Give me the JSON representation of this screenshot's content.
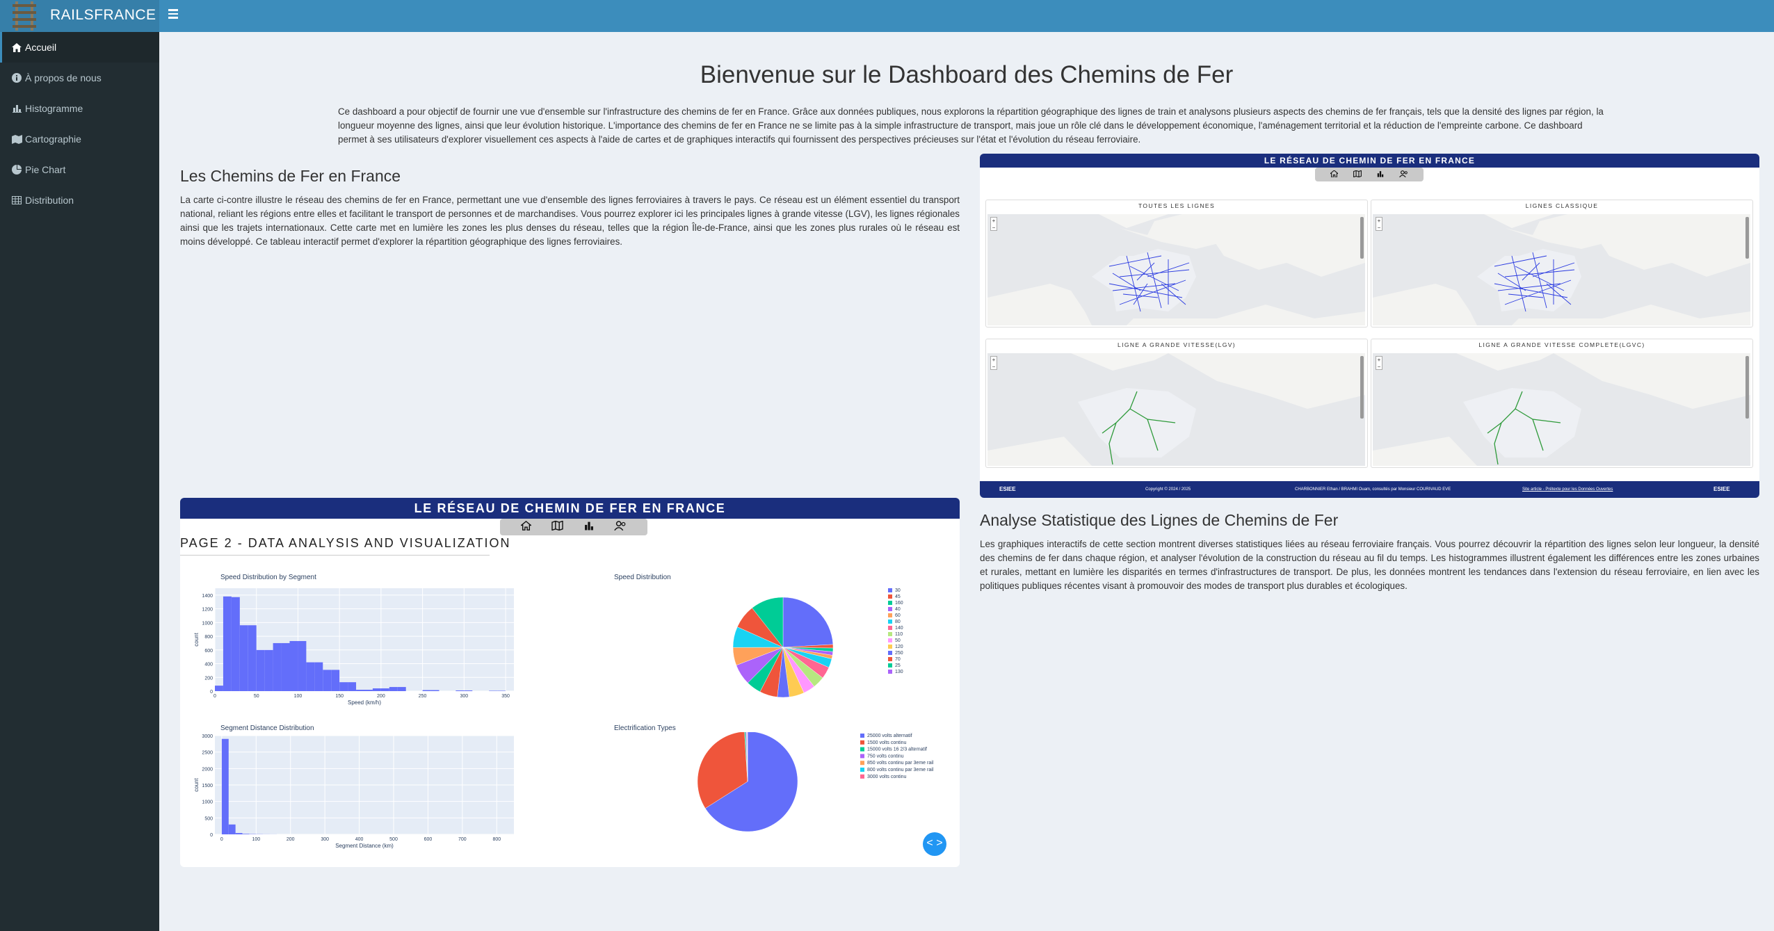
{
  "app": {
    "brand": "RAILSFRANCE"
  },
  "sidebar": {
    "items": [
      {
        "label": "Accueil",
        "icon": "home-icon",
        "active": true
      },
      {
        "label": "À propos de nous",
        "icon": "info-icon"
      },
      {
        "label": "Histogramme",
        "icon": "bar-chart-icon"
      },
      {
        "label": "Cartographie",
        "icon": "map-icon"
      },
      {
        "label": "Pie Chart",
        "icon": "pie-chart-icon"
      },
      {
        "label": "Distribution",
        "icon": "table-icon"
      }
    ]
  },
  "main": {
    "title": "Bienvenue sur le Dashboard des Chemins de Fer",
    "intro": "Ce dashboard a pour objectif de fournir une vue d'ensemble sur l'infrastructure des chemins de fer en France. Grâce aux données publiques, nous explorons la répartition géographique des lignes de train et analysons plusieurs aspects des chemins de fer français, tels que la densité des lignes par région, la longueur moyenne des lignes, ainsi que leur évolution historique. L'importance des chemins de fer en France ne se limite pas à la simple infrastructure de transport, mais joue un rôle clé dans le développement économique, l'aménagement territorial et la réduction de l'empreinte carbone. Ce dashboard permet à ses utilisateurs d'explorer visuellement ces aspects à l'aide de cartes et de graphiques interactifs qui fournissent des perspectives précieuses sur l'état et l'évolution du réseau ferroviaire.",
    "section1": {
      "heading": "Les Chemins de Fer en France",
      "text": "La carte ci-contre illustre le réseau des chemins de fer en France, permettant une vue d'ensemble des lignes ferroviaires à travers le pays. Ce réseau est un élément essentiel du transport national, reliant les régions entre elles et facilitant le transport de personnes et de marchandises. Vous pourrez explorer ici les principales lignes à grande vitesse (LGV), les lignes régionales ainsi que les trajets internationaux. Cette carte met en lumière les zones les plus denses du réseau, telles que la région Île-de-France, ainsi que les zones plus rurales où le réseau est moins développé. Ce tableau interactif permet d'explorer la répartition géographique des lignes ferroviaires."
    },
    "section2": {
      "heading": "Analyse Statistique des Lignes de Chemins de Fer",
      "text": "Les graphiques interactifs de cette section montrent diverses statistiques liées au réseau ferroviaire français. Vous pourrez découvrir la répartition des lignes selon leur longueur, la densité des chemins de fer dans chaque région, et analyser l'évolution de la construction du réseau au fil du temps. Les histogrammes illustrent également les différences entre les zones urbaines et rurales, mettant en lumière les disparités en termes d'infrastructures de transport. De plus, les données montrent les tendances dans l'extension du réseau ferroviaire, en lien avec les politiques publiques récentes visant à promouvoir des modes de transport plus durables et écologiques."
    }
  },
  "map_panel": {
    "banner": "LE RÉSEAU DE CHEMIN DE FER EN FRANCE",
    "maps": [
      {
        "title": "TOUTES LES LIGNES"
      },
      {
        "title": "LIGNES CLASSIQUE"
      },
      {
        "title": "LIGNE A GRANDE VITESSE(LGV)"
      },
      {
        "title": "LIGNE A GRANDE VITESSE COMPLETE(LGVC)"
      }
    ],
    "footer": {
      "logo_left": "ESIEE",
      "copyright": "Copyright © 2024 / 2025",
      "credits": "CHARBONNIER Ethan / BRAHMI Ouam, consultés par Monsieur COURIVAUD EVE",
      "source": "Site article - Prétexte pour les Données Ouvertes",
      "logo_right": "ESIEE"
    }
  },
  "data_panel": {
    "banner": "LE RÉSEAU DE CHEMIN DE FER EN FRANCE",
    "subtitle": "PAGE 2 - DATA ANALYSIS AND VISUALIZATION",
    "toggle": "< >"
  },
  "chart_data": [
    {
      "type": "bar",
      "title": "Speed Distribution by Segment",
      "xlabel": "Speed (km/h)",
      "ylabel": "count",
      "x": [
        5,
        15,
        25,
        35,
        45,
        55,
        65,
        75,
        85,
        95,
        105,
        115,
        125,
        135,
        145,
        155,
        165,
        175,
        185,
        195,
        205,
        215,
        225,
        235,
        245,
        255,
        265,
        275,
        285,
        295,
        305,
        315,
        325,
        335,
        345
      ],
      "values": [
        80,
        1380,
        1370,
        960,
        960,
        600,
        600,
        700,
        700,
        730,
        730,
        420,
        420,
        310,
        310,
        130,
        130,
        20,
        20,
        40,
        40,
        60,
        60,
        0,
        0,
        15,
        15,
        0,
        0,
        10,
        10,
        0,
        0,
        5,
        5
      ],
      "xlim": [
        0,
        360
      ],
      "ylim": [
        0,
        1500
      ],
      "xticks": [
        0,
        50,
        100,
        150,
        200,
        250,
        300,
        350
      ],
      "yticks": [
        0,
        200,
        400,
        600,
        800,
        1000,
        1200,
        1400
      ],
      "color": "#636efa"
    },
    {
      "type": "pie",
      "title": "Speed Distribution",
      "legend": [
        "30",
        "45",
        "160",
        "40",
        "60",
        "80",
        "140",
        "110",
        "50",
        "120",
        "250",
        "70",
        "25",
        "130"
      ],
      "slices": [
        {
          "value": 25,
          "color": "#636efa"
        },
        {
          "value": 1.2,
          "color": "#ef553b"
        },
        {
          "value": 1.2,
          "color": "#00cc96"
        },
        {
          "value": 1.2,
          "color": "#ab63fa"
        },
        {
          "value": 1.2,
          "color": "#ffa15a"
        },
        {
          "value": 3,
          "color": "#19d3f3"
        },
        {
          "value": 4,
          "color": "#ff6692"
        },
        {
          "value": 4,
          "color": "#b6e880"
        },
        {
          "value": 4,
          "color": "#ff97ff"
        },
        {
          "value": 5,
          "color": "#fecb52"
        },
        {
          "value": 4,
          "color": "#636efa"
        },
        {
          "value": 6,
          "color": "#ef553b"
        },
        {
          "value": 5,
          "color": "#00cc96"
        },
        {
          "value": 7,
          "color": "#ab63fa"
        },
        {
          "value": 6,
          "color": "#ffa15a"
        },
        {
          "value": 7,
          "color": "#19d3f3"
        },
        {
          "value": 8,
          "color": "#ef553b"
        },
        {
          "value": 11,
          "color": "#00cc96"
        }
      ],
      "legend_colors": [
        "#636efa",
        "#ef553b",
        "#00cc96",
        "#ab63fa",
        "#ffa15a",
        "#19d3f3",
        "#ff6692",
        "#b6e880",
        "#ff97ff",
        "#fecb52",
        "#636efa",
        "#ef553b",
        "#00cc96",
        "#ab63fa"
      ]
    },
    {
      "type": "bar",
      "title": "Segment Distance Distribution",
      "xlabel": "Segment Distance (km)",
      "ylabel": "count",
      "x": [
        10,
        30,
        50,
        70,
        90,
        110,
        130,
        150
      ],
      "values": [
        2900,
        300,
        40,
        15,
        8,
        5,
        3,
        2
      ],
      "xlim": [
        -20,
        850
      ],
      "ylim": [
        0,
        3000
      ],
      "xticks": [
        0,
        100,
        200,
        300,
        400,
        500,
        600,
        700,
        800
      ],
      "yticks": [
        0,
        500,
        1000,
        1500,
        2000,
        2500,
        3000
      ],
      "color": "#636efa"
    },
    {
      "type": "pie",
      "title": "Electrification Types",
      "legend": [
        "25000 volts alternatif",
        "1500 volts continu",
        "15000 volts 16 2/3 alternatif",
        "750 volts continu",
        "850 volts continu par 3eme rail",
        "800 volts continu par 3eme rail",
        "3000 volts continu"
      ],
      "slices": [
        {
          "value": 66,
          "color": "#636efa"
        },
        {
          "value": 33,
          "color": "#ef553b"
        },
        {
          "value": 0.4,
          "color": "#00cc96"
        },
        {
          "value": 0.3,
          "color": "#ab63fa"
        },
        {
          "value": 0.1,
          "color": "#ffa15a"
        },
        {
          "value": 0.1,
          "color": "#19d3f3"
        },
        {
          "value": 0.1,
          "color": "#ff6692"
        }
      ],
      "legend_colors": [
        "#636efa",
        "#ef553b",
        "#00cc96",
        "#ab63fa",
        "#ffa15a",
        "#19d3f3",
        "#ff6692"
      ]
    }
  ]
}
